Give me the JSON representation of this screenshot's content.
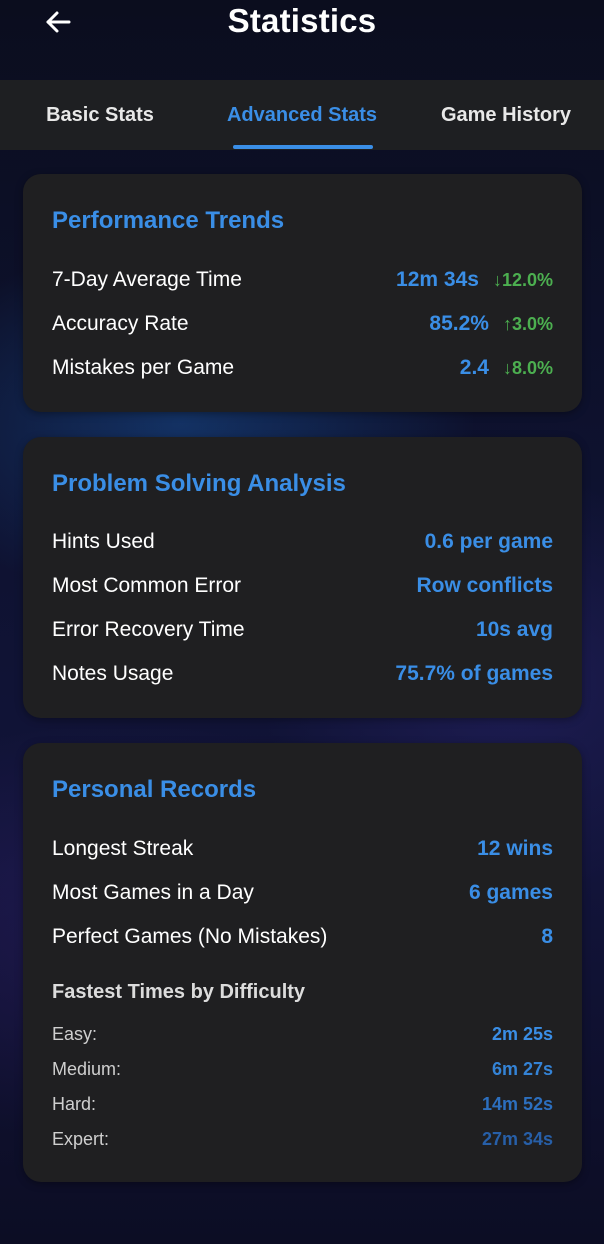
{
  "header": {
    "title": "Statistics",
    "back_icon": "arrow-left-icon"
  },
  "tabs": [
    {
      "label": "Basic Stats",
      "active": false
    },
    {
      "label": "Advanced Stats",
      "active": true
    },
    {
      "label": "Game History",
      "active": false
    }
  ],
  "colors": {
    "accent": "#3a8ee6",
    "positive": "#4caf50",
    "card": "#1f1f21",
    "tabbar": "#1e1f22"
  },
  "performance": {
    "title": "Performance Trends",
    "rows": [
      {
        "label": "7-Day Average Time",
        "value": "12m 34s",
        "delta": "↓12.0%"
      },
      {
        "label": "Accuracy Rate",
        "value": "85.2%",
        "delta": "↑3.0%"
      },
      {
        "label": "Mistakes per Game",
        "value": "2.4",
        "delta": "↓8.0%"
      }
    ]
  },
  "problem_solving": {
    "title": "Problem Solving Analysis",
    "rows": [
      {
        "label": "Hints Used",
        "value": "0.6 per game"
      },
      {
        "label": "Most Common Error",
        "value": "Row conflicts"
      },
      {
        "label": "Error Recovery Time",
        "value": "10s avg"
      },
      {
        "label": "Notes Usage",
        "value": "75.7% of games"
      }
    ]
  },
  "records": {
    "title": "Personal Records",
    "rows": [
      {
        "label": "Longest Streak",
        "value": "12 wins"
      },
      {
        "label": "Most Games in a Day",
        "value": "6 games"
      },
      {
        "label": "Perfect Games (No Mistakes)",
        "value": "8"
      }
    ],
    "fastest_title": "Fastest Times by Difficulty",
    "fastest": [
      {
        "label": "Easy:",
        "value": "2m 25s",
        "color": "#3a8ee6"
      },
      {
        "label": "Medium:",
        "value": "6m 27s",
        "color": "#3483d6"
      },
      {
        "label": "Hard:",
        "value": "14m 52s",
        "color": "#2c6fbf"
      },
      {
        "label": "Expert:",
        "value": "27m 34s",
        "color": "#275fa8"
      }
    ]
  }
}
